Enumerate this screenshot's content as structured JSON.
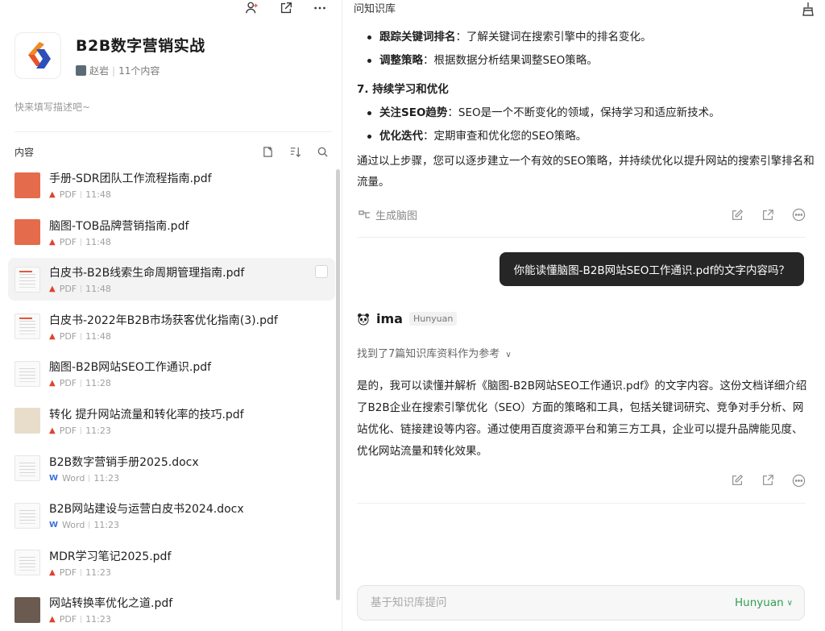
{
  "toolbar": {
    "icons": [
      "person-add-icon",
      "share-icon",
      "more-icon"
    ]
  },
  "kb": {
    "title": "B2B数字营销实战",
    "owner": "赵岩",
    "count": "11个内容",
    "description": "快来填写描述吧~"
  },
  "content_section": {
    "title": "内容",
    "tools": [
      "add-file-icon",
      "sort-icon",
      "search-icon"
    ]
  },
  "files": [
    {
      "name": "手册-SDR团队工作流程指南.pdf",
      "type": "PDF",
      "time": "11:48"
    },
    {
      "name": "脑图-TOB品牌营销指南.pdf",
      "type": "PDF",
      "time": "11:48"
    },
    {
      "name": "白皮书-B2B线索生命周期管理指南.pdf",
      "type": "PDF",
      "time": "11:48"
    },
    {
      "name": "白皮书-2022年B2B市场获客优化指南(3).pdf",
      "type": "PDF",
      "time": "11:48"
    },
    {
      "name": "脑图-B2B网站SEO工作通识.pdf",
      "type": "PDF",
      "time": "11:28"
    },
    {
      "name": "转化 提升网站流量和转化率的技巧.pdf",
      "type": "PDF",
      "time": "11:23"
    },
    {
      "name": "B2B数字营销手册2025.docx",
      "type": "Word",
      "time": "11:23"
    },
    {
      "name": "B2B网站建设与运营白皮书2024.docx",
      "type": "Word",
      "time": "11:23"
    },
    {
      "name": "MDR学习笔记2025.pdf",
      "type": "PDF",
      "time": "11:23"
    },
    {
      "name": "网站转换率优化之道.pdf",
      "type": "PDF",
      "time": "11:23"
    }
  ],
  "chat": {
    "title": "问知识库",
    "prev_answer": {
      "bullets_a": [
        {
          "bold": "跟踪关键词排名",
          "text": "：了解关键词在搜索引擎中的排名变化。"
        },
        {
          "bold": "调整策略",
          "text": "：根据数据分析结果调整SEO策略。"
        }
      ],
      "heading": "7. 持续学习和优化",
      "bullets_b": [
        {
          "bold": "关注SEO趋势",
          "text": "：SEO是一个不断变化的领域，保持学习和适应新技术。"
        },
        {
          "bold": "优化迭代",
          "text": "：定期审查和优化您的SEO策略。"
        }
      ],
      "summary": "通过以上步骤，您可以逐步建立一个有效的SEO策略，并持续优化以提升网站的搜索引擎排名和流量。",
      "mindmap_label": "生成脑图"
    },
    "user_question": "你能读懂脑图-B2B网站SEO工作通识.pdf的文字内容吗？",
    "bot": {
      "name": "ima",
      "model_tag": "Hunyuan",
      "refs": "找到了7篇知识库资料作为参考",
      "answer": "是的，我可以读懂并解析《脑图-B2B网站SEO工作通识.pdf》的文字内容。这份文档详细介绍了B2B企业在搜索引擎优化（SEO）方面的策略和工具，包括关键词研究、竞争对手分析、网站优化、链接建设等内容。通过使用百度资源平台和第三方工具，企业可以提升品牌能见度、优化网站流量和转化效果。"
    },
    "input": {
      "placeholder": "基于知识库提问",
      "value": ""
    },
    "model_select": "Hunyuan"
  }
}
